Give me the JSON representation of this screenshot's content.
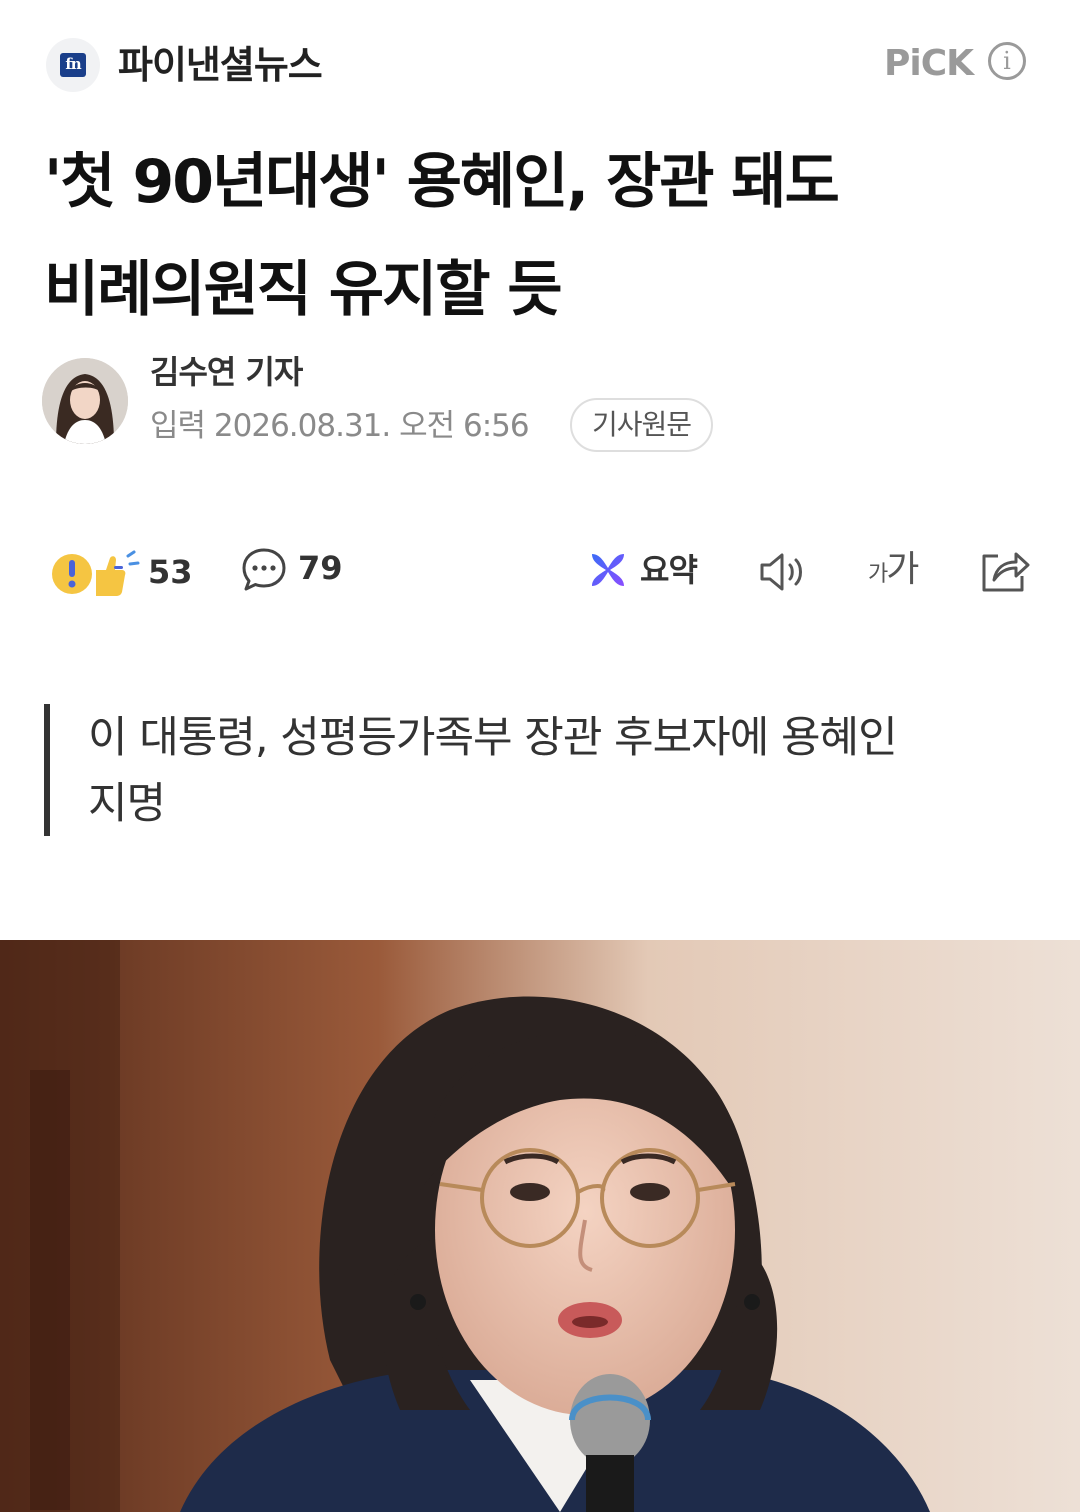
{
  "header": {
    "press_logo_text": "fn",
    "press_name": "파이낸셜뉴스",
    "pick_label": "PiCK",
    "info_glyph": "i"
  },
  "article": {
    "headline_line1": "'첫 90년대생' 용혜인, 장관 돼도",
    "headline_line2": "비례의원직 유지할 듯",
    "reporter": "김수연 기자",
    "date": "입력 2026.08.31. 오전 6:56",
    "original_link": "기사원문",
    "subhead_line1": "이 대통령, 성평등가족부 장관 후보자에 용혜인",
    "subhead_line2": "지명"
  },
  "toolbar": {
    "reaction_count": "53",
    "comment_count": "79",
    "summary_label": "요약",
    "font_small": "가",
    "font_big": "가"
  },
  "icons": [
    "press-logo",
    "info-icon",
    "reaction-icon",
    "comment-icon",
    "summary-icon",
    "speaker-icon",
    "font-size-icon",
    "share-icon"
  ],
  "colors": {
    "text": "#111111",
    "muted": "#8a8a8a",
    "pick_gray": "#9a9a9a",
    "press_blue": "#1a3f8a",
    "summary_blue": "#3b6cf6",
    "summary_purple": "#8a4dff"
  }
}
